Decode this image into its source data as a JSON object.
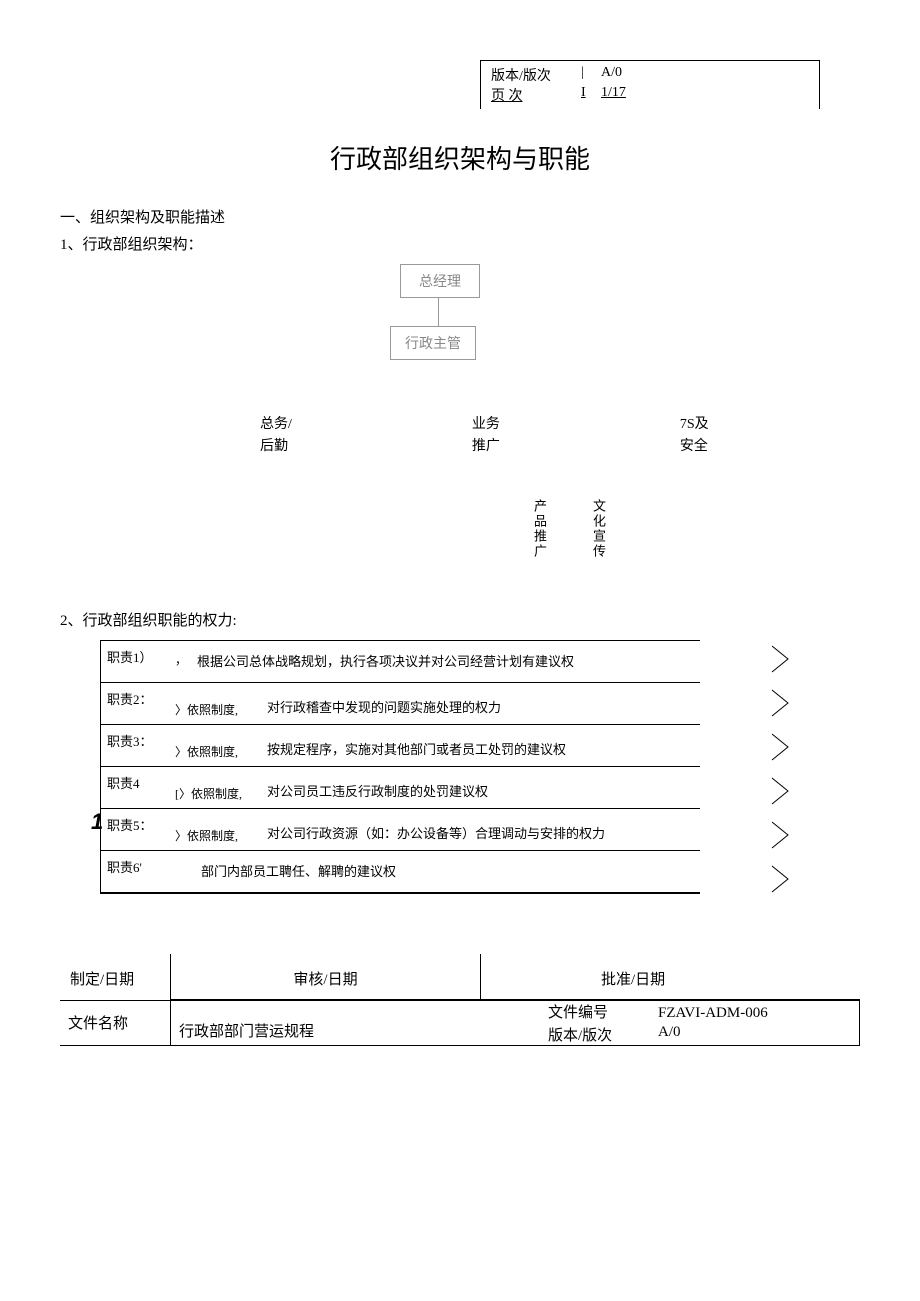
{
  "header": {
    "version_label": "版本/版次",
    "version_sep": "|",
    "version_value": "A/0",
    "page_label": "页 次",
    "page_sep": "I",
    "page_value": "1/17"
  },
  "title": "行政部组织架构与职能",
  "section1": "一、组织架构及职能描述",
  "section1_1": "1、行政部组织架构：",
  "org": {
    "top": "总经理",
    "mid": "行政主管"
  },
  "row": {
    "a1": "总务/",
    "a2": "后勤",
    "b1": "业务",
    "b2": "推广",
    "c1": "7S及",
    "c2": "安全"
  },
  "vert": {
    "a": "产品推广",
    "b": "文化宣传"
  },
  "section2": "2、行政部组织职能的权力:",
  "duties": [
    {
      "label": "职责1）",
      "mid": "，",
      "body": "根据公司总体战略规划，执行各项决议并对公司经营计划有建议权"
    },
    {
      "label": "职责2：",
      "mid": "〉依照制度,",
      "body": "对行政稽查中发现的问题实施处理的权力"
    },
    {
      "label": "职责3：",
      "mid": "〉依照制度,",
      "body": "按规定程序，实施对其他部门或者员工处罚的建议权"
    },
    {
      "label": "职责4",
      "mid": "[〉依照制度,",
      "body": "对公司员工违反行政制度的处罚建议权"
    },
    {
      "label": "职责5：",
      "mid": "〉依照制度,",
      "body": "对公司行政资源（如：办公设备等）合理调动与安排的权力"
    },
    {
      "label": "职责6'",
      "mid": "",
      "body": "部门内部员工聘任、解聘的建议权"
    }
  ],
  "footer": {
    "r1": {
      "a": "制定/日期",
      "b": "审核/日期",
      "c": "批准/日期"
    },
    "r2": {
      "a": "文件名称",
      "b": "行政部部门营运规程",
      "c1": "文件编号",
      "c2": "版本/版次",
      "d1": "FZAVI-ADM-006",
      "d2": "A/0"
    }
  },
  "handmark": "1"
}
